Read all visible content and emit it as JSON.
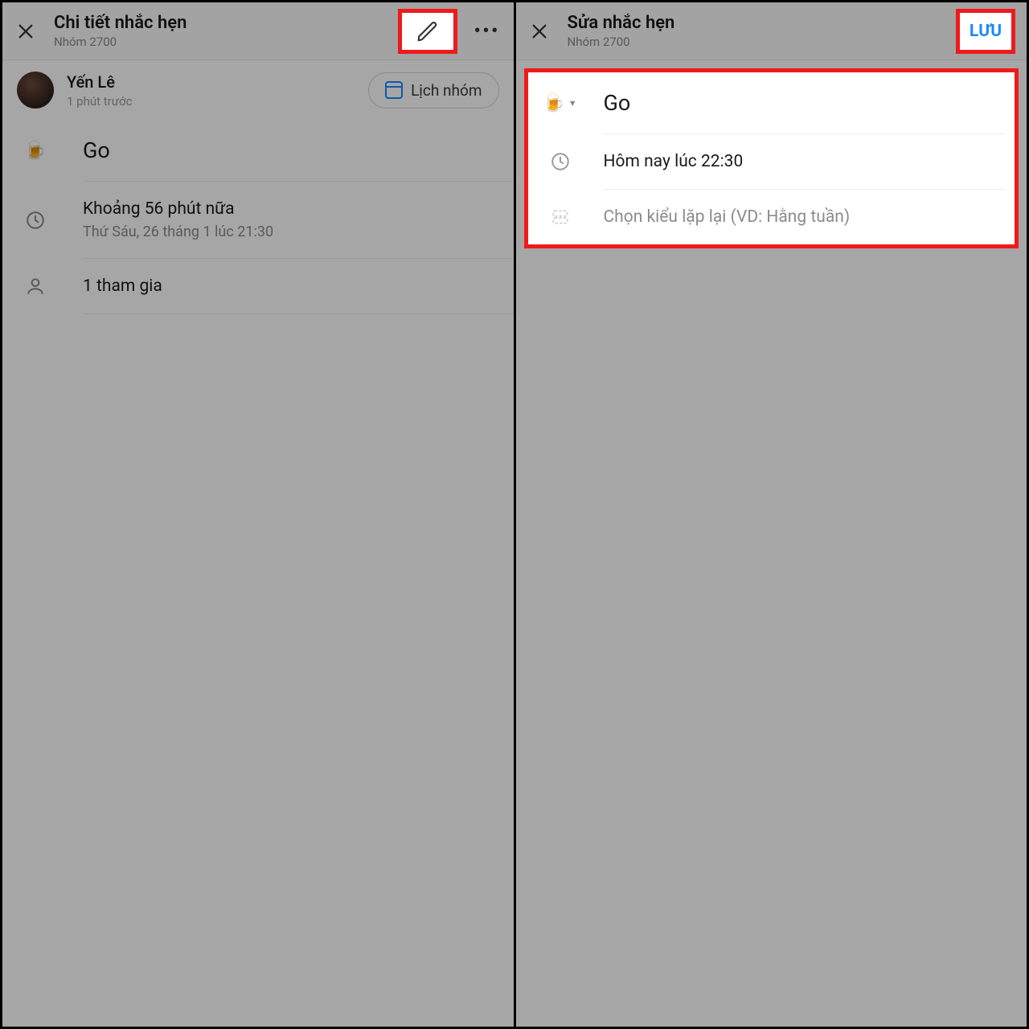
{
  "left": {
    "header": {
      "title": "Chi tiết nhắc hẹn",
      "subtitle": "Nhóm 2700"
    },
    "author": {
      "name": "Yến Lê",
      "time": "1 phút trước"
    },
    "calendar_chip": "Lịch nhóm",
    "event": {
      "icon": "🍺",
      "title": "Go"
    },
    "time": {
      "relative": "Khoảng 56 phút nữa",
      "absolute": "Thứ Sáu, 26 tháng 1 lúc 21:30"
    },
    "participants": "1 tham gia"
  },
  "right": {
    "header": {
      "title": "Sửa nhắc hẹn",
      "subtitle": "Nhóm 2700",
      "save": "LƯU"
    },
    "event": {
      "icon": "🍺",
      "title": "Go"
    },
    "time": "Hôm nay lúc 22:30",
    "repeat_placeholder": "Chọn kiểu lặp lại (VD: Hằng tuần)"
  }
}
